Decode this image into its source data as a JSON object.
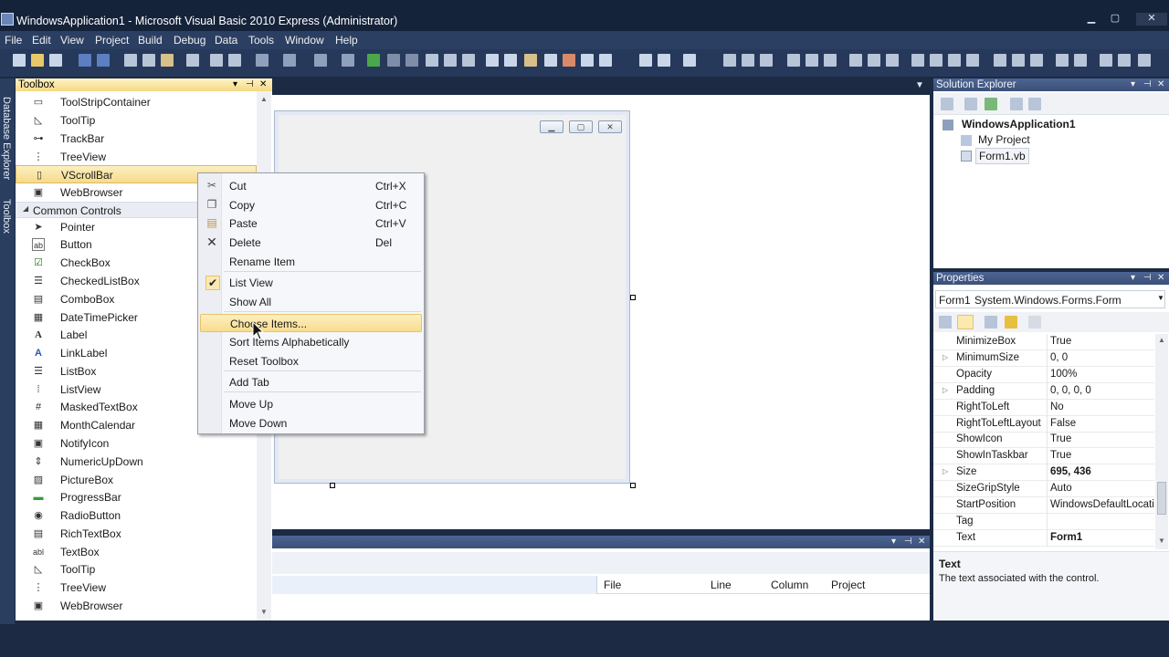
{
  "window": {
    "title": "WindowsApplication1 - Microsoft Visual Basic 2010 Express (Administrator)",
    "min_glyph": "▁",
    "max_glyph": "▢",
    "close_glyph": "✕"
  },
  "menu": [
    "File",
    "Edit",
    "View",
    "Project",
    "Build",
    "Debug",
    "Data",
    "Tools",
    "Window",
    "Help"
  ],
  "side_tabs": {
    "database_explorer": "Database Explorer",
    "toolbox": "Toolbox"
  },
  "toolbox": {
    "title": "Toolbox",
    "items_top": [
      {
        "label": "ToolStripContainer",
        "icon": "▭"
      },
      {
        "label": "ToolTip",
        "icon": "◺"
      },
      {
        "label": "TrackBar",
        "icon": "⊶"
      },
      {
        "label": "TreeView",
        "icon": "⋮"
      },
      {
        "label": "VScrollBar",
        "icon": "▯"
      },
      {
        "label": "WebBrowser",
        "icon": "▣"
      }
    ],
    "group": "Common Controls",
    "items": [
      {
        "label": "Pointer",
        "icon": "➤"
      },
      {
        "label": "Button",
        "icon": "ab"
      },
      {
        "label": "CheckBox",
        "icon": "☑"
      },
      {
        "label": "CheckedListBox",
        "icon": "☰"
      },
      {
        "label": "ComboBox",
        "icon": "▤"
      },
      {
        "label": "DateTimePicker",
        "icon": "▦"
      },
      {
        "label": "Label",
        "icon": "A"
      },
      {
        "label": "LinkLabel",
        "icon": "A"
      },
      {
        "label": "ListBox",
        "icon": "☰"
      },
      {
        "label": "ListView",
        "icon": "⁞"
      },
      {
        "label": "MaskedTextBox",
        "icon": "#"
      },
      {
        "label": "MonthCalendar",
        "icon": "▦"
      },
      {
        "label": "NotifyIcon",
        "icon": "▣"
      },
      {
        "label": "NumericUpDown",
        "icon": "⇕"
      },
      {
        "label": "PictureBox",
        "icon": "▨"
      },
      {
        "label": "ProgressBar",
        "icon": "▬"
      },
      {
        "label": "RadioButton",
        "icon": "◉"
      },
      {
        "label": "RichTextBox",
        "icon": "▤"
      },
      {
        "label": "TextBox",
        "icon": "abl"
      },
      {
        "label": "ToolTip",
        "icon": "◺"
      },
      {
        "label": "TreeView",
        "icon": "⋮"
      },
      {
        "label": "WebBrowser",
        "icon": "▣"
      }
    ]
  },
  "context_menu": {
    "cut": {
      "label": "Cut",
      "shortcut": "Ctrl+X"
    },
    "copy": {
      "label": "Copy",
      "shortcut": "Ctrl+C"
    },
    "paste": {
      "label": "Paste",
      "shortcut": "Ctrl+V"
    },
    "delete": {
      "label": "Delete",
      "shortcut": "Del"
    },
    "rename": "Rename Item",
    "list_view": "List View",
    "show_all": "Show All",
    "choose_items": "Choose Items...",
    "sort": "Sort Items Alphabetically",
    "reset": "Reset Toolbox",
    "add_tab": "Add Tab",
    "move_up": "Move Up",
    "move_down": "Move Down"
  },
  "error_list": {
    "columns": [
      "File",
      "Line",
      "Column",
      "Project"
    ]
  },
  "solution_explorer": {
    "title": "Solution Explorer",
    "solution": "WindowsApplication1",
    "children": [
      "My Project",
      "Form1.vb"
    ]
  },
  "properties": {
    "title": "Properties",
    "object_name": "Form1",
    "object_type": "System.Windows.Forms.Form",
    "rows": [
      {
        "name": "MinimizeBox",
        "value": "True"
      },
      {
        "name": "MinimumSize",
        "value": "0, 0"
      },
      {
        "name": "Opacity",
        "value": "100%"
      },
      {
        "name": "Padding",
        "value": "0, 0, 0, 0"
      },
      {
        "name": "RightToLeft",
        "value": "No"
      },
      {
        "name": "RightToLeftLayout",
        "value": "False"
      },
      {
        "name": "ShowIcon",
        "value": "True"
      },
      {
        "name": "ShowInTaskbar",
        "value": "True"
      },
      {
        "name": "Size",
        "value": "695, 436"
      },
      {
        "name": "SizeGripStyle",
        "value": "Auto"
      },
      {
        "name": "StartPosition",
        "value": "WindowsDefaultLocation"
      },
      {
        "name": "Tag",
        "value": ""
      },
      {
        "name": "Text",
        "value": "Form1"
      }
    ],
    "desc_title": "Text",
    "desc_text": "The text associated with the control."
  },
  "colors": {
    "accent": "#f6da8a",
    "chrome": "#1c2a44"
  }
}
